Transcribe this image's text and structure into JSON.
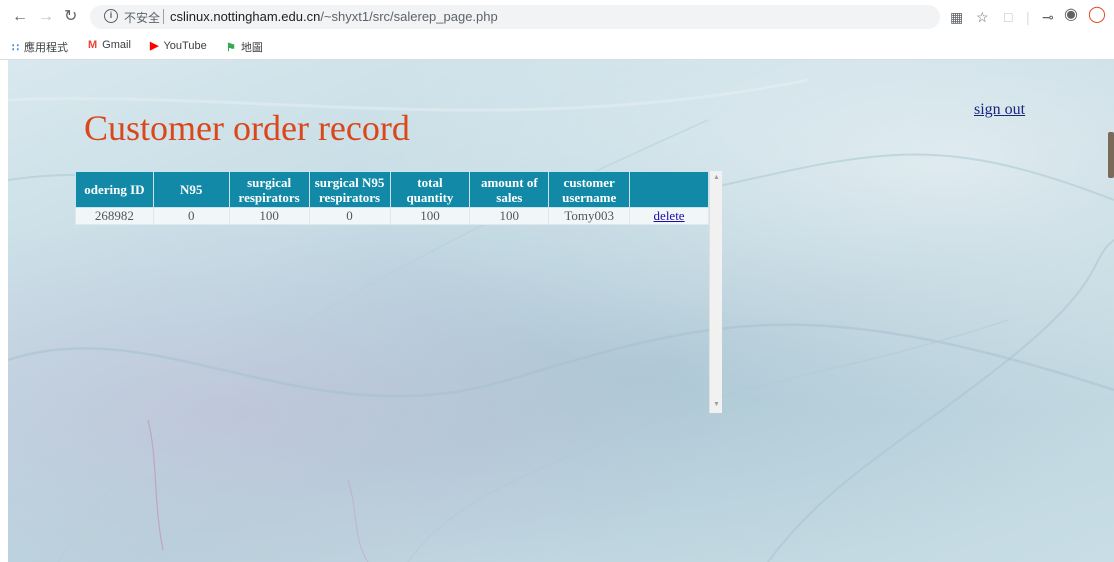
{
  "browser": {
    "insecure_label": "不安全",
    "url_host": "cslinux.nottingham.edu.cn",
    "url_path": "/~shyxt1/src/salerep_page.php",
    "bookmarks": [
      {
        "label": "應用程式",
        "icon": "apps-grid-icon"
      },
      {
        "label": "Gmail",
        "icon": "gmail-icon"
      },
      {
        "label": "YouTube",
        "icon": "youtube-icon"
      },
      {
        "label": "地圖",
        "icon": "maps-icon"
      }
    ]
  },
  "page": {
    "title": "Customer order record",
    "sign_out": "sign out"
  },
  "table": {
    "headers": [
      "odering ID",
      "N95",
      "surgical respirators",
      "surgical N95 respirators",
      "total quantity",
      "amount of sales",
      "customer username",
      ""
    ],
    "rows": [
      {
        "ordering_id": "268982",
        "n95": "0",
        "surgical": "100",
        "surgical_n95": "0",
        "total": "100",
        "amount": "100",
        "username": "Tomy003",
        "action": "delete"
      }
    ]
  },
  "colors": {
    "title": "#d9471a",
    "header_bg": "#1289a7",
    "link": "#1a0dab"
  }
}
